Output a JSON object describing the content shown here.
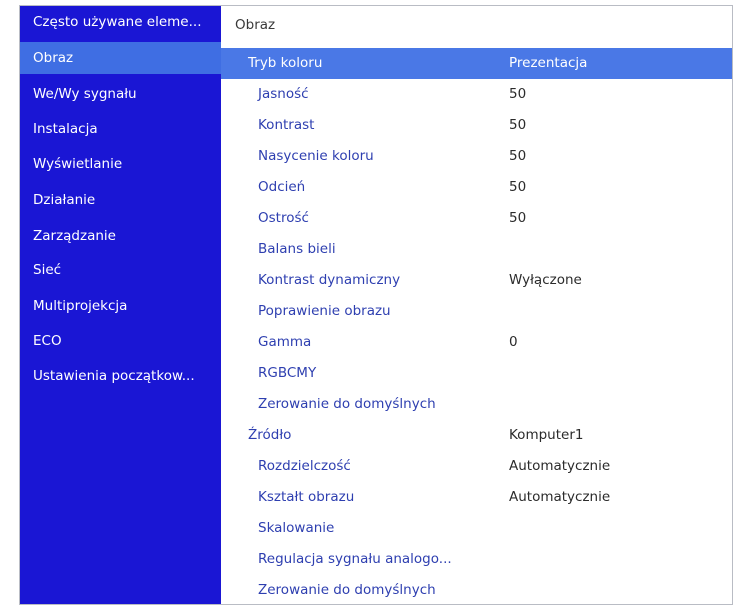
{
  "sidebar": {
    "items": [
      {
        "label": "Często używane eleme..."
      },
      {
        "label": "Obraz"
      },
      {
        "label": "We/Wy sygnału"
      },
      {
        "label": "Instalacja"
      },
      {
        "label": "Wyświetlanie"
      },
      {
        "label": "Działanie"
      },
      {
        "label": "Zarządzanie"
      },
      {
        "label": "Sieć"
      },
      {
        "label": "Multiprojekcja"
      },
      {
        "label": "ECO"
      },
      {
        "label": "Ustawienia początkow..."
      }
    ],
    "selected": "Obraz"
  },
  "content": {
    "header": "Obraz",
    "rows": [
      {
        "label": "Tryb koloru",
        "value": "Prezentacja"
      },
      {
        "label": "Jasność",
        "value": "50"
      },
      {
        "label": "Kontrast",
        "value": "50"
      },
      {
        "label": "Nasycenie koloru",
        "value": "50"
      },
      {
        "label": "Odcień",
        "value": "50"
      },
      {
        "label": "Ostrość",
        "value": "50"
      },
      {
        "label": "Balans bieli",
        "value": ""
      },
      {
        "label": "Kontrast dynamiczny",
        "value": "Wyłączone"
      },
      {
        "label": "Poprawienie obrazu",
        "value": ""
      },
      {
        "label": "Gamma",
        "value": "0"
      },
      {
        "label": "RGBCMY",
        "value": ""
      },
      {
        "label": "Zerowanie do domyślnych",
        "value": ""
      },
      {
        "label": "Źródło",
        "value": "Komputer1"
      },
      {
        "label": "Rozdzielczość",
        "value": "Automatycznie"
      },
      {
        "label": "Kształt obrazu",
        "value": "Automatycznie"
      },
      {
        "label": "Skalowanie",
        "value": ""
      },
      {
        "label": "Regulacja sygnału analogo...",
        "value": ""
      },
      {
        "label": "Zerowanie do domyślnych",
        "value": ""
      }
    ],
    "selected": "Tryb koloru"
  },
  "colors": {
    "sidebar_bg": "#1a16d4",
    "sidebar_selected": "#3f6ee3",
    "row_selected": "#4a78e6",
    "label_text": "#2e3fb0"
  }
}
